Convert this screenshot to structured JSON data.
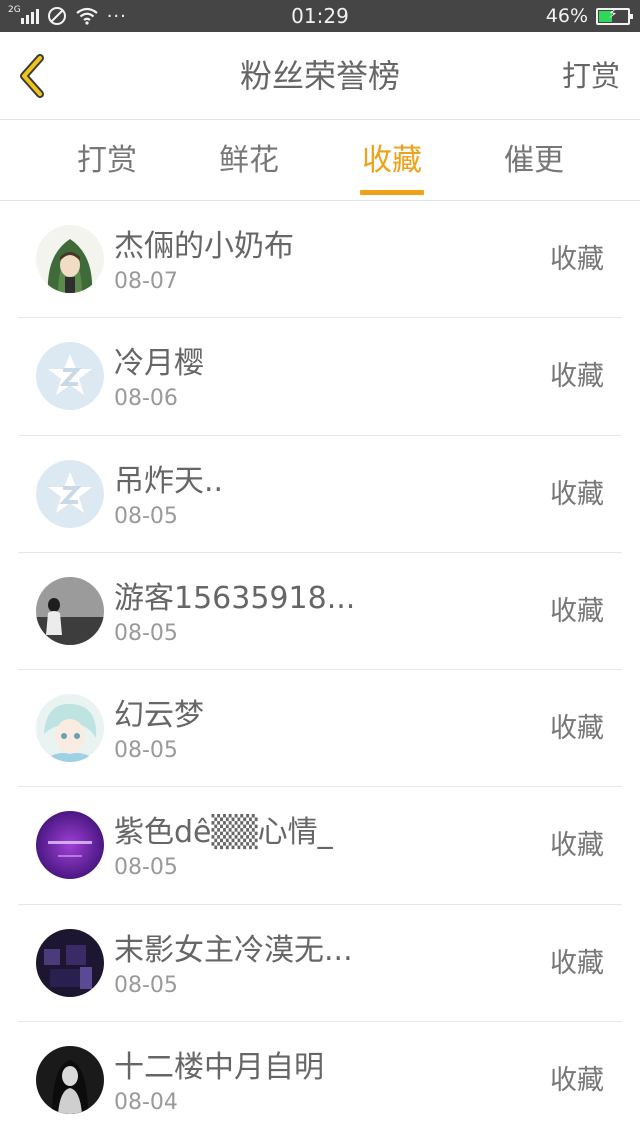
{
  "status_bar": {
    "network": "2G",
    "time": "01:29",
    "battery": "46%",
    "battery_level": 0.46,
    "more_glyph": "···"
  },
  "header": {
    "title": "粉丝荣誉榜",
    "reward_label": "打赏",
    "back_icon": "chevron-left-icon",
    "accent_color": "#f0a11a"
  },
  "tabs": [
    {
      "label": "打赏",
      "active": false
    },
    {
      "label": "鲜花",
      "active": false
    },
    {
      "label": "收藏",
      "active": true
    },
    {
      "label": "催更",
      "active": false
    }
  ],
  "fans": [
    {
      "name": "杰倆的小奶布",
      "date": "08-07",
      "action": "收藏",
      "avatar": "green-hood-avatar"
    },
    {
      "name": "冷月樱",
      "date": "08-06",
      "action": "收藏",
      "avatar": "default-star-avatar"
    },
    {
      "name": "吊炸天..",
      "date": "08-05",
      "action": "收藏",
      "avatar": "default-star-avatar"
    },
    {
      "name": "游客15635918...",
      "date": "08-05",
      "action": "收藏",
      "avatar": "gray-photo-avatar"
    },
    {
      "name": "幻云梦",
      "date": "08-05",
      "action": "收藏",
      "avatar": "anime-avatar"
    },
    {
      "name": "紫色dê▒▒心情_",
      "date": "08-05",
      "action": "收藏",
      "avatar": "purple-avatar"
    },
    {
      "name": "末影女主冷漠无...",
      "date": "08-05",
      "action": "收藏",
      "avatar": "dark-game-avatar"
    },
    {
      "name": "十二楼中月自明",
      "date": "08-04",
      "action": "收藏",
      "avatar": "dark-portrait-avatar"
    }
  ]
}
